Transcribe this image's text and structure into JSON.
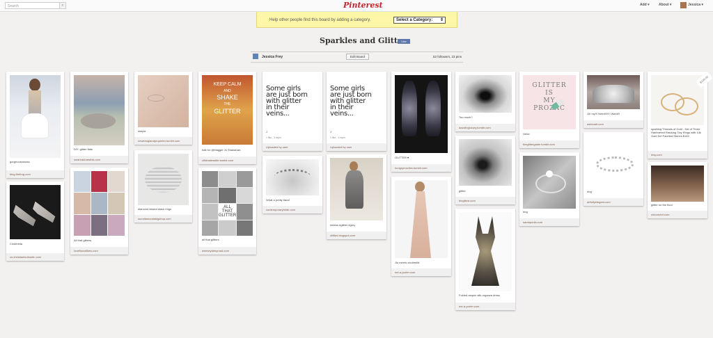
{
  "topbar": {
    "search_placeholder": "Search",
    "logo": "Pinterest",
    "nav_add": "Add ▾",
    "nav_about": "About ▾",
    "nav_user": "Jessica ▾"
  },
  "banner": {
    "text": "Help other people find this board by adding a category.",
    "select_value": "Select a Category:"
  },
  "board": {
    "title": "Sparkles and Glitter",
    "like": "Like",
    "owner": "Jessica Frey",
    "edit": "Edit Board",
    "followers": "52 followers, 23 pins"
  },
  "pins": [
    {
      "desc": "gorgeousssssss",
      "source": "bing.thefrog.com"
    },
    {
      "desc": "Cinderella",
      "source": "us.christianlouboutin.com"
    },
    {
      "desc": "DIY: glitter flats",
      "source": "weareadoresthis.com"
    },
    {
      "desc": "All that glitters",
      "source": "lovefisandlikes.com"
    },
    {
      "desc": "simple",
      "source": "neweenglandproperter.tumblr.com"
    },
    {
      "desc": "diamond kissed stack rings",
      "source": "sumdiamondsbigshop.com"
    },
    {
      "desc": "halt for @Maggie Jo Shanahan..",
      "source": "cfitdradesstile.tumblr.com",
      "img_text": [
        "KEEP CALM",
        "AND",
        "SHAKE",
        "THE",
        "GLITTER"
      ]
    },
    {
      "desc": "all that glitters",
      "source": "weeseydeeyroad.com",
      "img_text": [
        "ALL",
        "THAT",
        "GLITTER"
      ]
    },
    {
      "desc": "J",
      "stat": "1 like · 1 repin",
      "source": "Uploaded by user",
      "img_text": [
        "Some girls",
        "are just born",
        "with glitter",
        "in their",
        "veins..."
      ]
    },
    {
      "desc": "What a pretty tiara!",
      "source": "contemporarybride.com"
    },
    {
      "desc": "J",
      "stat": "1 like · 1 repin",
      "source": "Uploaded by user",
      "img_text": [
        "Some girls",
        "are just born",
        "with glitter",
        "in their",
        "veins..."
      ]
    },
    {
      "desc": "#dress #glitter #grey",
      "source": "oliified.blogspot.com"
    },
    {
      "desc": "GLITTER ♥",
      "source": "hungrymovlies.tumblr.com"
    },
    {
      "desc": "Jlo meets cinderella",
      "source": "net-a-porter.com"
    },
    {
      "desc": "Too much?",
      "source": "dazzlingluxury.tumblr.com"
    },
    {
      "desc": "glitter",
      "source": "bingfava.com"
    },
    {
      "desc": "Folded-sequin silk-organza dress",
      "source": "net-a-porter.com"
    },
    {
      "desc": "Hehe.",
      "source": "theglittergalde.tumblr.com",
      "img_text": [
        "GLITTER",
        "IS",
        "MY",
        "PROZAC"
      ]
    },
    {
      "desc": "ring",
      "source": "sarahperils.com"
    },
    {
      "desc": "Oh my!!! Need!!!!!!! Want!!!",
      "source": "wehearit.com"
    },
    {
      "desc": "ring",
      "source": "artfullyelegant.com"
    },
    {
      "desc": "sparking Threads of Gold - Set of Three Hammered Stacking Tiny Rings with 14k Gold Set Faceted Stones $149",
      "source": "etsy.com",
      "price": "$149.00"
    },
    {
      "desc": "glitter on the floor",
      "source": "cincosved.com"
    }
  ],
  "colors": {
    "brand": "#c8232c",
    "banner": "#fff7a8",
    "page_bg": "#f3f1f0"
  }
}
